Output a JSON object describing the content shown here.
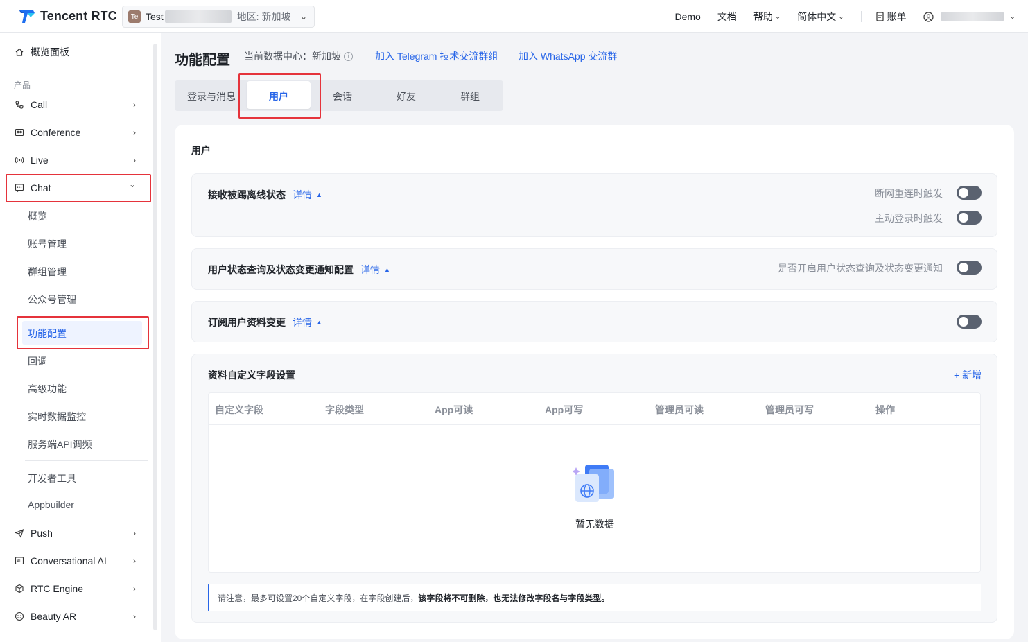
{
  "header": {
    "logo_text": "Tencent RTC",
    "app_badge": "Te",
    "app_name": "Test",
    "app_region": "地区: 新加坡",
    "nav": {
      "demo": "Demo",
      "docs": "文档",
      "help": "帮助",
      "language": "简体中文",
      "billing": "账单"
    }
  },
  "sidebar": {
    "overview": "概览面板",
    "group_label": "产品",
    "call": "Call",
    "conference": "Conference",
    "live": "Live",
    "chat": "Chat",
    "chat_sub": {
      "overview": "概览",
      "accounts": "账号管理",
      "groups": "群组管理",
      "official": "公众号管理",
      "features": "功能配置",
      "callback": "回调",
      "advanced": "高级功能",
      "monitor": "实时数据监控",
      "api_debug": "服务端API调频",
      "devtools": "开发者工具",
      "appbuilder": "Appbuilder"
    },
    "push": "Push",
    "conversational_ai": "Conversational AI",
    "rtc_engine": "RTC Engine",
    "beauty_ar": "Beauty AR"
  },
  "main": {
    "title": "功能配置",
    "datacenter": "当前数据中心：新加坡",
    "link_telegram": "加入 Telegram 技术交流群组",
    "link_whatsapp": "加入 WhatsApp 交流群",
    "tabs": [
      "登录与消息",
      "用户",
      "会话",
      "好友",
      "群组"
    ],
    "active_tab": "用户",
    "section_title": "用户",
    "panels": {
      "kick_offline": {
        "title": "接收被踢离线状态",
        "detail": "详情",
        "option1": "断网重连时触发",
        "option2": "主动登录时触发"
      },
      "status_query": {
        "title": "用户状态查询及状态变更通知配置",
        "detail": "详情",
        "option1": "是否开启用户状态查询及状态变更通知"
      },
      "subscribe_profile": {
        "title": "订阅用户资料变更",
        "detail": "详情"
      },
      "custom_fields": {
        "title": "资料自定义字段设置",
        "add": "+ 新增",
        "columns": [
          "自定义字段",
          "字段类型",
          "App可读",
          "App可写",
          "管理员可读",
          "管理员可写",
          "操作"
        ],
        "empty": "暂无数据",
        "note_prefix": "请注意，最多可设置20个自定义字段，在字段创建后，",
        "note_bold": "该字段将不可删除，也无法修改字段名与字段类型。"
      }
    }
  },
  "colors": {
    "accent": "#2765e8",
    "highlight_box": "#e5333b",
    "toggle_off": "#5a6270"
  }
}
